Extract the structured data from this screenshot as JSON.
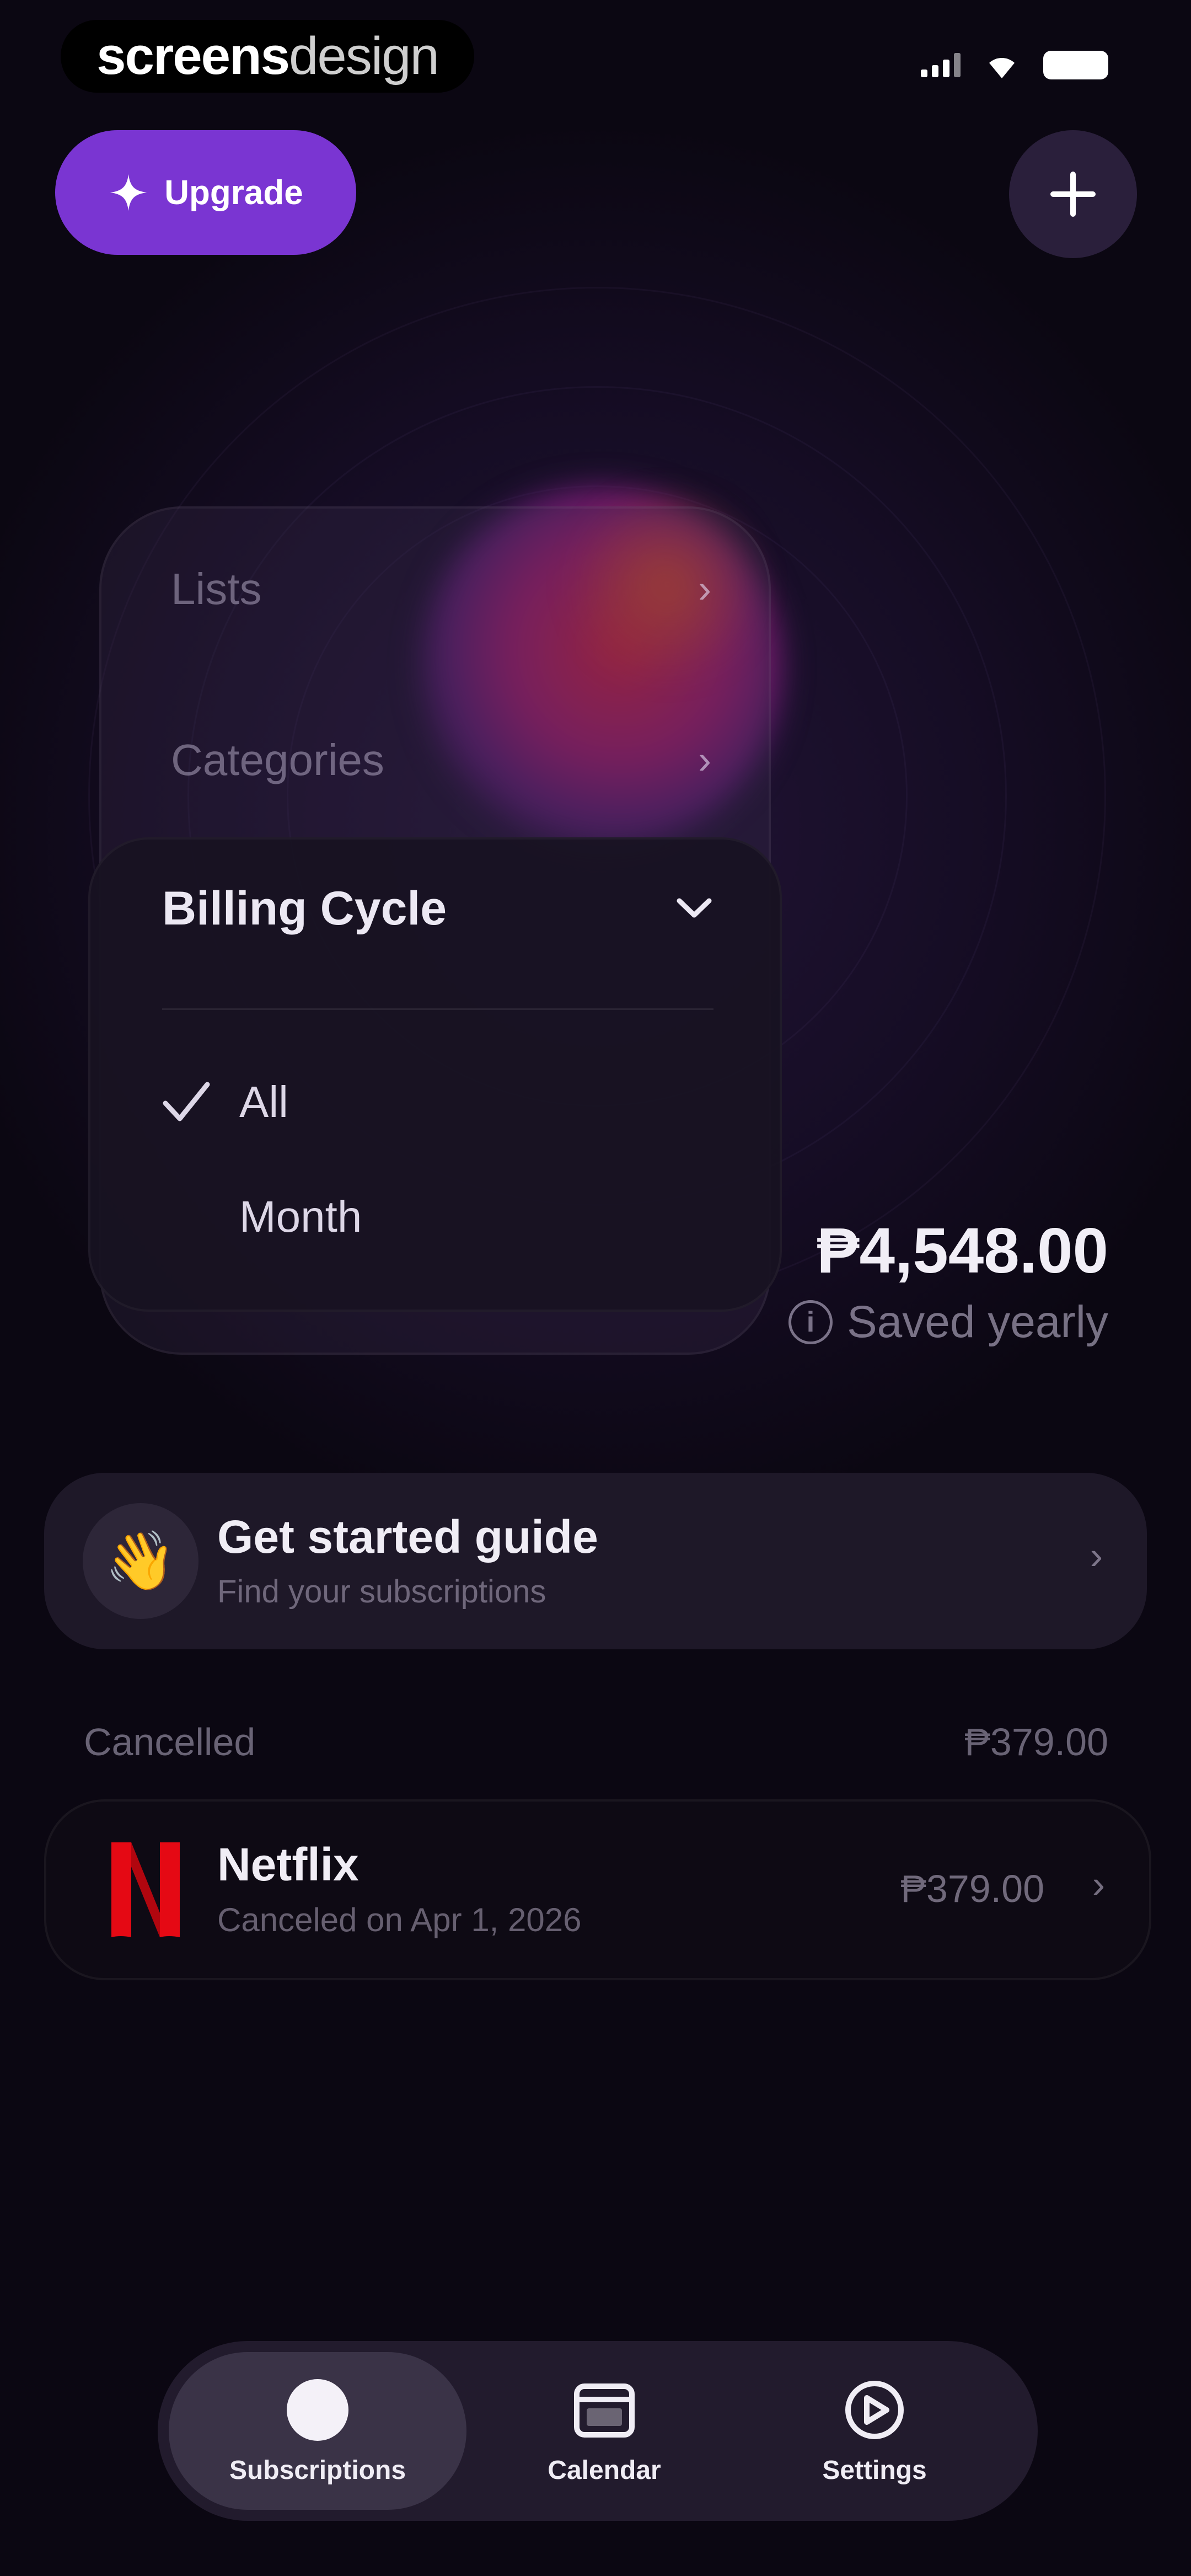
{
  "status_bar": {
    "brand_bold": "screens",
    "brand_light": "design"
  },
  "header": {
    "upgrade_label": "Upgrade",
    "add_icon": "plus-icon"
  },
  "menu": {
    "items": [
      {
        "label": "Lists",
        "icon": "chevron-right-icon"
      },
      {
        "label": "Categories",
        "icon": "chevron-right-icon"
      }
    ],
    "billing_cycle": {
      "title": "Billing Cycle",
      "icon": "chevron-down-icon",
      "options": [
        {
          "label": "All",
          "selected": true
        },
        {
          "label": "Month",
          "selected": false
        }
      ]
    }
  },
  "savings": {
    "amount": "₱4,548.00",
    "label": "Saved yearly"
  },
  "guide": {
    "icon": "waving-hand-icon",
    "title": "Get started guide",
    "subtitle": "Find your subscriptions"
  },
  "cancelled": {
    "section_label": "Cancelled",
    "section_total": "₱379.00",
    "items": [
      {
        "name": "Netflix",
        "date": "Canceled on Apr 1, 2026",
        "price": "₱379.00",
        "icon": "netflix-logo"
      }
    ]
  },
  "tabs": [
    {
      "label": "Subscriptions",
      "icon": "subscriptions-icon",
      "active": true
    },
    {
      "label": "Calendar",
      "icon": "calendar-icon",
      "active": false
    },
    {
      "label": "Settings",
      "icon": "settings-icon",
      "active": false
    }
  ],
  "colors": {
    "accent": "#7a35d2",
    "background": "#0b0712",
    "netflix": "#e50914"
  }
}
